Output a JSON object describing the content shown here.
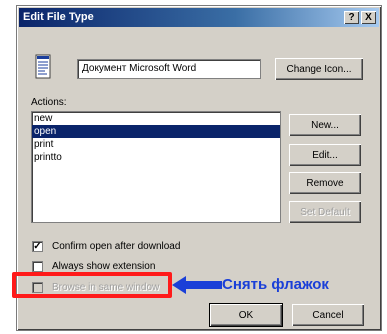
{
  "window": {
    "title": "Edit File Type",
    "help_button": "?",
    "close_button": "X"
  },
  "file_type": {
    "description": "Документ Microsoft Word",
    "change_icon_label": "Change Icon..."
  },
  "actions": {
    "label": "Actions:",
    "items": [
      "new",
      "open",
      "print",
      "printto"
    ],
    "selected": "open"
  },
  "action_buttons": {
    "new": "New...",
    "edit": "Edit...",
    "remove": "Remove",
    "set_default": "Set Default"
  },
  "options": [
    {
      "label": "Confirm open after download",
      "checked": true,
      "enabled": true
    },
    {
      "label": "Always show extension",
      "checked": false,
      "enabled": true
    },
    {
      "label": "Browse in same window",
      "checked": false,
      "enabled": false
    }
  ],
  "dialog_buttons": {
    "ok": "OK",
    "cancel": "Cancel"
  },
  "annotation": {
    "text": "Снять флажок",
    "box_color": "#ff1a1a",
    "arrow_color": "#1a3fd8"
  }
}
